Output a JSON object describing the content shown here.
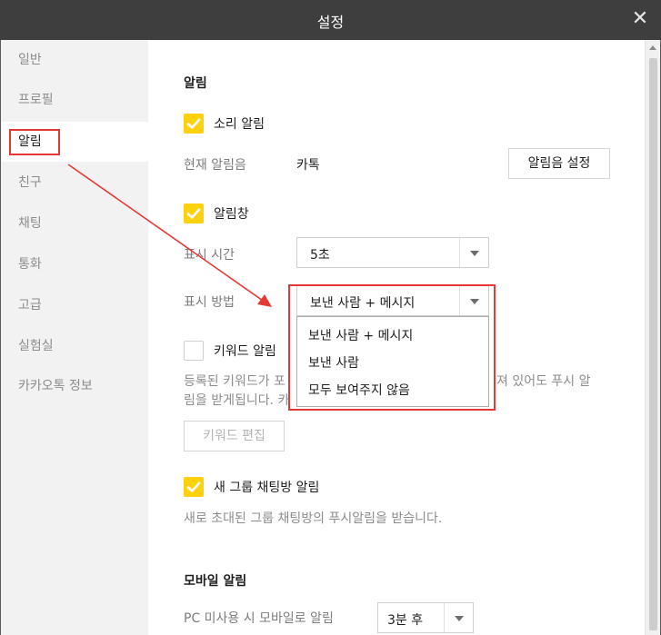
{
  "window": {
    "title": "설정",
    "close_icon": "close-icon"
  },
  "sidebar": {
    "items": [
      {
        "label": "일반"
      },
      {
        "label": "프로필"
      },
      {
        "label": "알림"
      },
      {
        "label": "친구"
      },
      {
        "label": "채팅"
      },
      {
        "label": "통화"
      },
      {
        "label": "고급"
      },
      {
        "label": "실험실"
      },
      {
        "label": "카카오톡 정보"
      }
    ]
  },
  "notifications": {
    "section_title": "알림",
    "sound": {
      "label": "소리 알림",
      "checked": true
    },
    "current_sound_label": "현재 알림음",
    "current_sound_value": "카톡",
    "sound_settings_button": "알림음 설정",
    "popup": {
      "label": "알림창",
      "checked": true
    },
    "display_time_label": "표시 시간",
    "display_time_value": "5초",
    "display_method_label": "표시 방법",
    "display_method_value": "보낸 사람 + 메시지",
    "display_method_options": [
      "보낸 사람 + 메시지",
      "보낸 사람",
      "모두 보여주지 않음"
    ],
    "keyword": {
      "label": "키워드 알림",
      "checked": false
    },
    "keyword_desc_line1_left": "등록된 키워드가 포",
    "keyword_desc_line1_right": "져 있어도 푸시 알",
    "keyword_desc_line2_left": "림을 받게됩니다. 카",
    "keyword_edit_button": "키워드 편집",
    "new_group": {
      "label": "새 그룹 채팅방 알림",
      "checked": true
    },
    "new_group_desc": "새로 초대된 그룹 채팅방의 푸시알림을 받습니다."
  },
  "mobile": {
    "section_title": "모바일 알림",
    "pc_unused_label": "PC 미사용 시 모바일로 알림",
    "pc_unused_value": "3분 후"
  },
  "colors": {
    "accent": "#fcd20f",
    "titlebar": "#3e3e3e",
    "annotation": "#e53935"
  }
}
